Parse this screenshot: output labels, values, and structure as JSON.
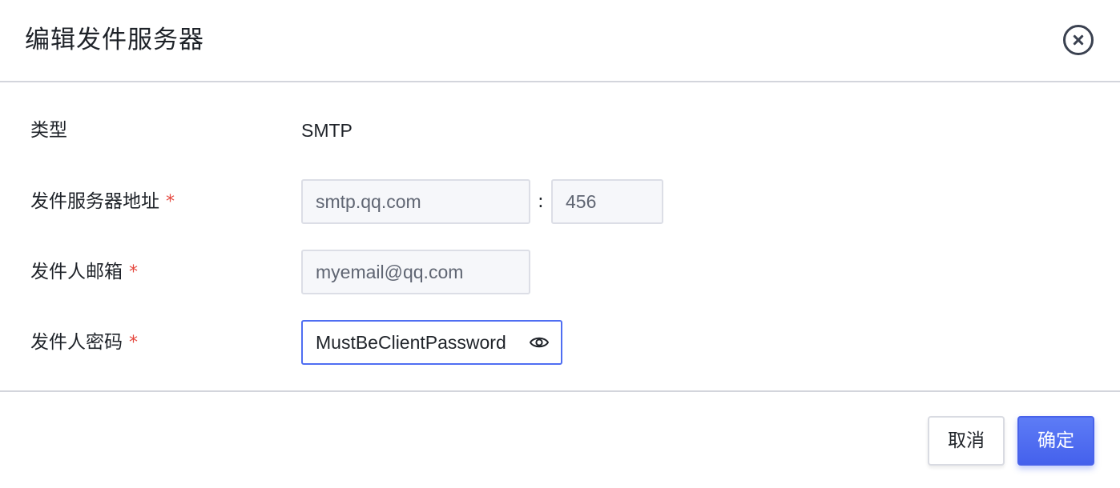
{
  "dialog": {
    "title": "编辑发件服务器",
    "close_icon": "close-circle-icon"
  },
  "form": {
    "type": {
      "label": "类型",
      "value": "SMTP"
    },
    "server": {
      "label": "发件服务器地址",
      "required_mark": "*",
      "host_value": "smtp.qq.com",
      "separator": ":",
      "port_value": "456"
    },
    "sender_email": {
      "label": "发件人邮箱",
      "required_mark": "*",
      "value": "myemail@qq.com"
    },
    "sender_password": {
      "label": "发件人密码",
      "required_mark": "*",
      "value": "MustBeClientPassword",
      "toggle_icon": "eye-icon"
    }
  },
  "footer": {
    "cancel_label": "取消",
    "confirm_label": "确定"
  },
  "colors": {
    "primary": "#4f6ef2",
    "required": "#e5483f",
    "input_bg": "#f6f7fa"
  }
}
